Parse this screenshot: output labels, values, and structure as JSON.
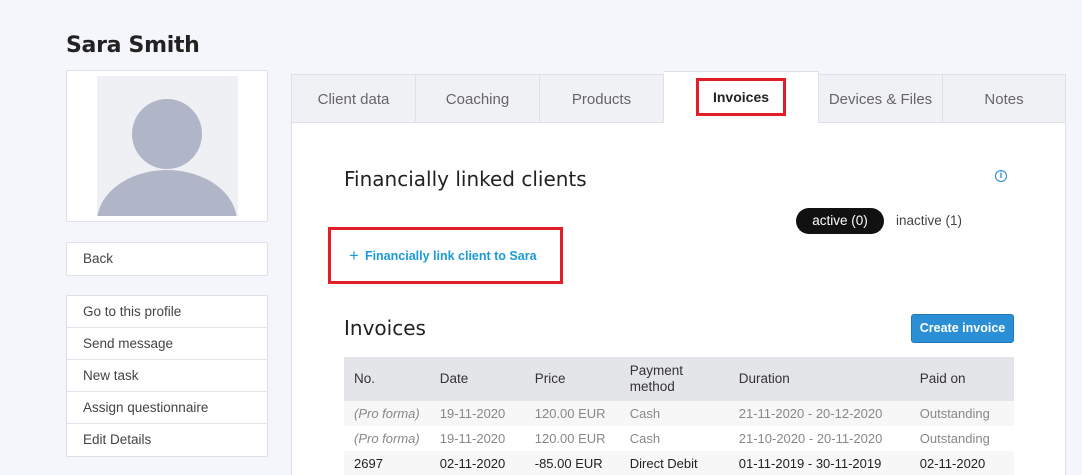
{
  "client": {
    "name": "Sara Smith"
  },
  "sidebar": {
    "back_label": "Back",
    "actions": [
      {
        "label": "Go to this profile"
      },
      {
        "label": "Send message"
      },
      {
        "label": "New task"
      },
      {
        "label": "Assign questionnaire"
      },
      {
        "label": "Edit Details"
      }
    ]
  },
  "tabs": [
    {
      "label": "Client data"
    },
    {
      "label": "Coaching"
    },
    {
      "label": "Products"
    },
    {
      "label": "Invoices"
    },
    {
      "label": "Devices & Files"
    },
    {
      "label": "Notes"
    }
  ],
  "linked_clients": {
    "title": "Financially linked clients",
    "info_icon": "info-icon",
    "active_label": "active (0)",
    "inactive_label": "inactive (1)",
    "link_button_label": "Financially link client to Sara",
    "link_button_icon": "plus-icon"
  },
  "invoices": {
    "title": "Invoices",
    "create_button_label": "Create invoice",
    "columns": [
      "No.",
      "Date",
      "Price",
      "Payment method",
      "Duration",
      "Paid on"
    ],
    "rows": [
      {
        "no": "(Pro forma)",
        "date": "19-11-2020",
        "price": "120.00 EUR",
        "method": "Cash",
        "duration": "21-11-2020 - 20-12-2020",
        "paid_on": "Outstanding"
      },
      {
        "no": "(Pro forma)",
        "date": "19-11-2020",
        "price": "120.00 EUR",
        "method": "Cash",
        "duration": "21-10-2020 - 20-11-2020",
        "paid_on": "Outstanding"
      },
      {
        "no": "2697",
        "date": "02-11-2020",
        "price": "-85.00 EUR",
        "method": "Direct Debit",
        "duration": "01-11-2019 - 30-11-2019",
        "paid_on": "02-11-2020"
      }
    ]
  },
  "colors": {
    "accent": "#1a9bd7",
    "button": "#2b8fd6",
    "highlight": "#e41e26",
    "toggle_active": "#111111"
  }
}
